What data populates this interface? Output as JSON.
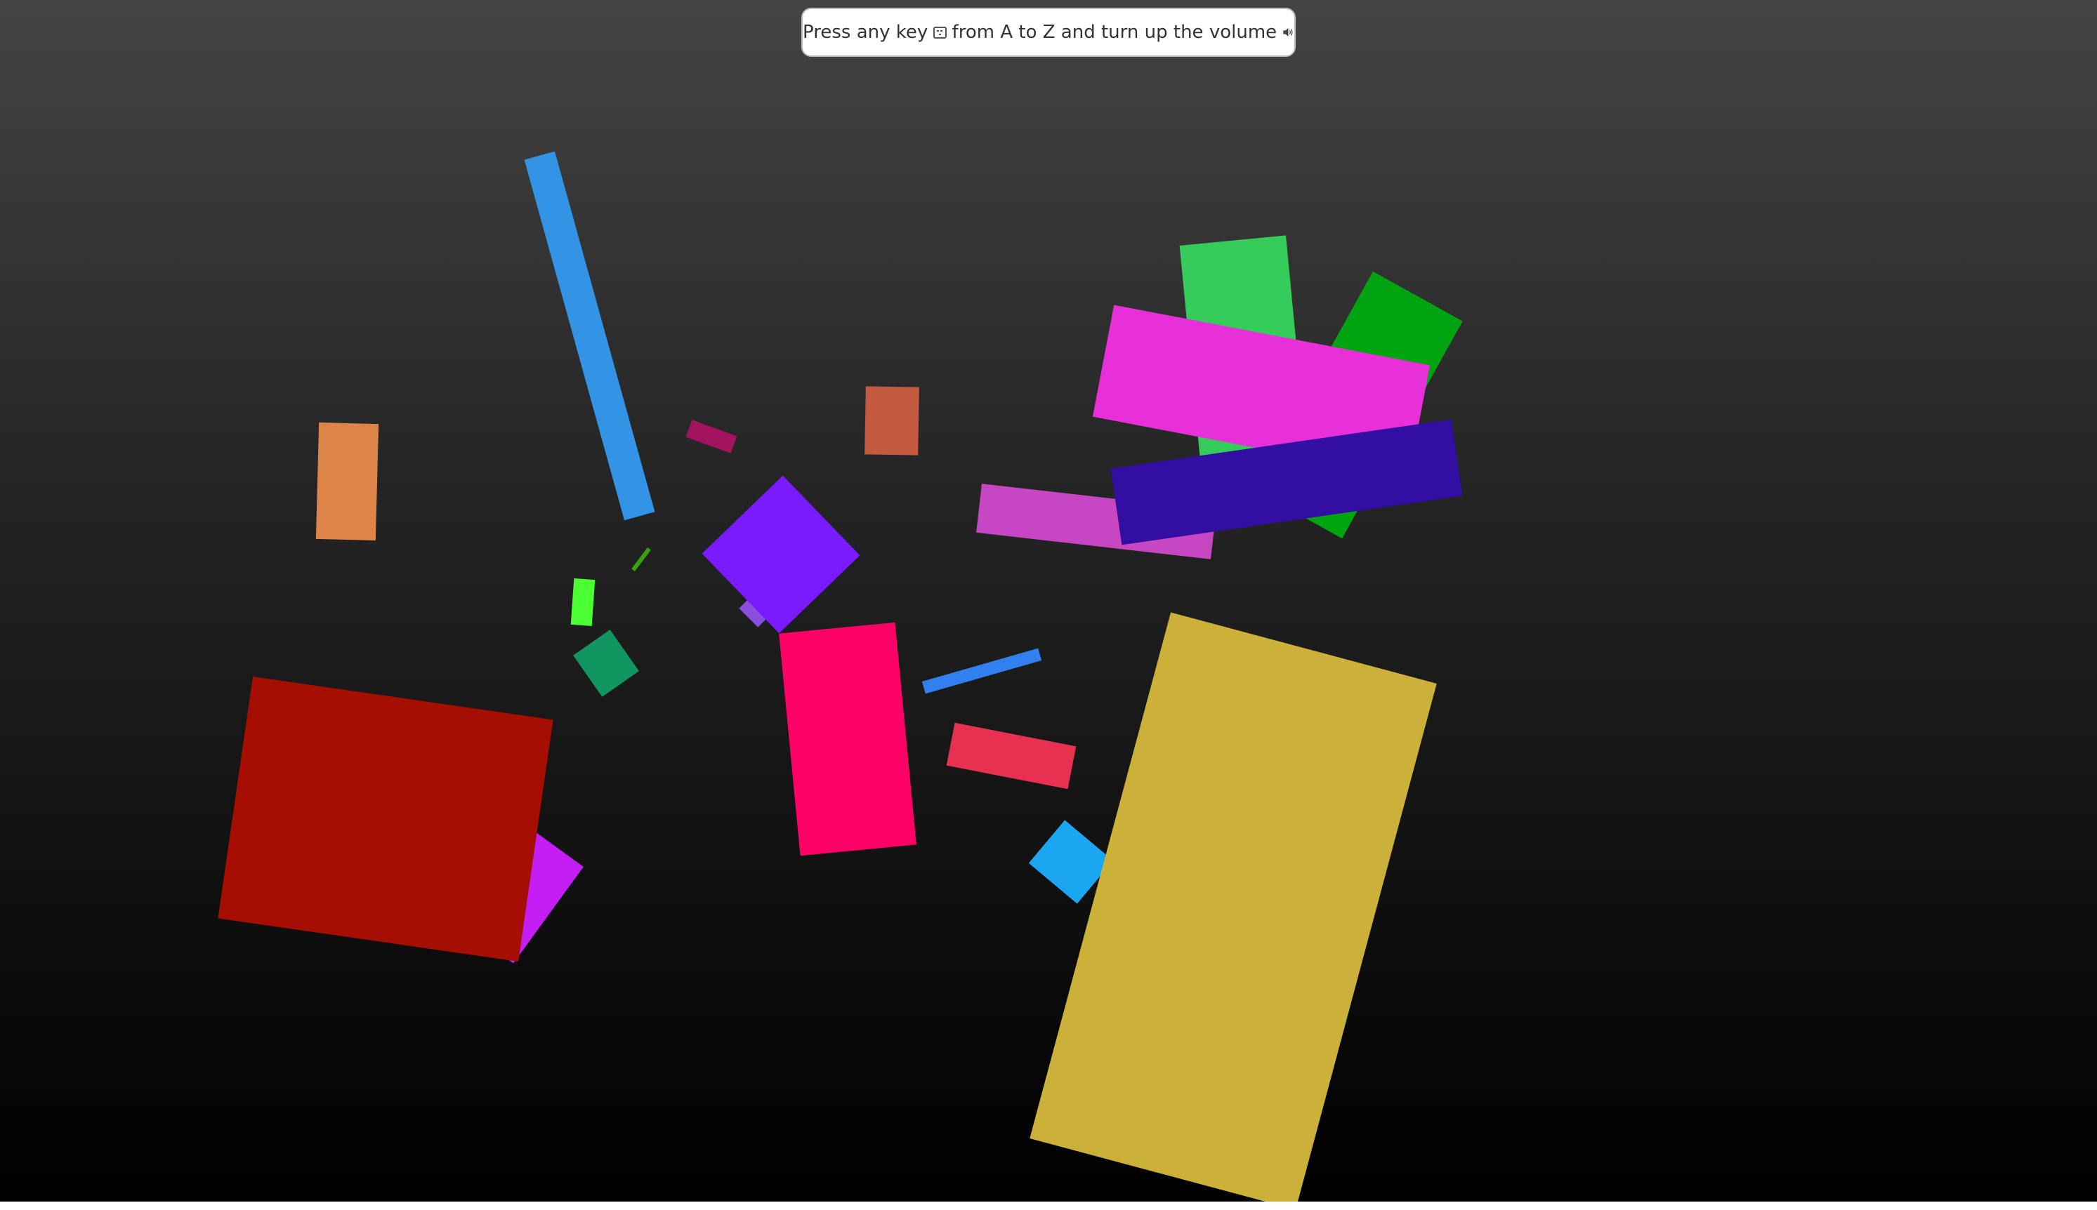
{
  "hint": {
    "text_before": "Press any key",
    "text_after": "from A to Z and turn up the volume",
    "keyboard_icon": "keyboard-icon",
    "speaker_icon": "speaker-volume-icon"
  },
  "shapes": [
    {
      "name": "shape-blue-long-bar",
      "color": "#3393e5"
    },
    {
      "name": "shape-orange-rect",
      "color": "#dd8449"
    },
    {
      "name": "shape-maroon-small",
      "color": "#a3135e"
    },
    {
      "name": "shape-terracotta-rect",
      "color": "#c45a40"
    },
    {
      "name": "shape-violet-rect",
      "color": "#7a1aff"
    },
    {
      "name": "shape-lavender-small",
      "color": "#8b4fe0"
    },
    {
      "name": "shape-green-line",
      "color": "#3aa010"
    },
    {
      "name": "shape-lime-rect",
      "color": "#4cff33"
    },
    {
      "name": "shape-teal-rect",
      "color": "#129661"
    },
    {
      "name": "shape-purple-rotated",
      "color": "#c51ef5"
    },
    {
      "name": "shape-dark-red-rect",
      "color": "#a50e00"
    },
    {
      "name": "shape-pink-rect",
      "color": "#ff0066"
    },
    {
      "name": "shape-blue-thin-bar",
      "color": "#3080f0"
    },
    {
      "name": "shape-coral-rect",
      "color": "#e83050"
    },
    {
      "name": "shape-cyan-rect",
      "color": "#1aa6f0"
    },
    {
      "name": "shape-gold-large",
      "color": "#cbb13a"
    },
    {
      "name": "shape-mint-green-rect",
      "color": "#36cc5c"
    },
    {
      "name": "shape-dark-green-rect",
      "color": "#00a410"
    },
    {
      "name": "shape-orchid-bar",
      "color": "#c746c2"
    },
    {
      "name": "shape-magenta-bar",
      "color": "#e830d8"
    },
    {
      "name": "shape-indigo-bar",
      "color": "#320ea3"
    }
  ]
}
